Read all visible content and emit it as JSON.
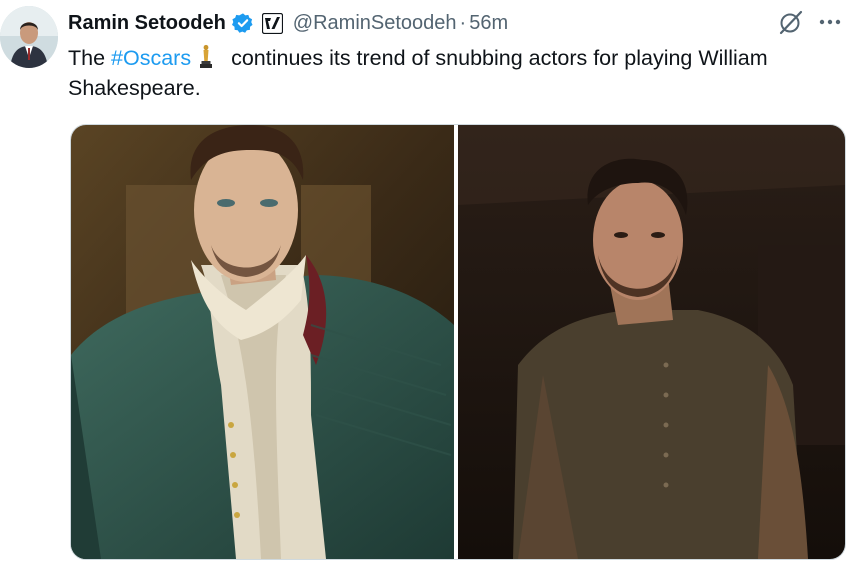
{
  "tweet": {
    "author_name": "Ramin Setoodeh",
    "handle": "@RaminSetoodeh",
    "separator": "·",
    "time": "56m",
    "text_before": "The ",
    "hashtag": "#Oscars",
    "text_after": " continues its trend of snubbing actors for playing William Shakespeare."
  },
  "icons": {
    "verified": "verified-badge-icon",
    "affiliate": "affiliate-badge-icon",
    "grok": "grok-icon",
    "more": "more-icon",
    "trophy": "oscar-trophy-emoji"
  },
  "colors": {
    "accent": "#1d9bf0",
    "text": "#0f1419",
    "muted": "#536471",
    "border": "#cfd9de"
  }
}
